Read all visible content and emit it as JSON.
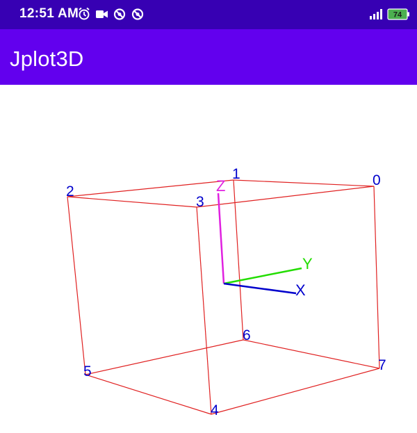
{
  "status_bar": {
    "time": "12:51 AM",
    "battery_level": "74",
    "icons_left": [
      "alarm-icon",
      "video-camera-icon",
      "do-not-disturb-icon",
      "sync-off-icon"
    ],
    "icons_right": [
      "signal-icon",
      "battery-icon"
    ]
  },
  "app_bar": {
    "title": "Jplot3D",
    "background": "#6200ee",
    "status_background": "#3700b3"
  },
  "plot": {
    "vertex_labels": [
      "0",
      "1",
      "2",
      "3",
      "4",
      "5",
      "6",
      "7"
    ],
    "axis_labels": {
      "x": "X",
      "y": "Y",
      "z": "Z"
    },
    "colors": {
      "edges": "#e02020",
      "vertex_labels": "#0000cc",
      "x_axis": "#0000cc",
      "y_axis": "#22dd00",
      "z_axis": "#e020e0"
    }
  }
}
